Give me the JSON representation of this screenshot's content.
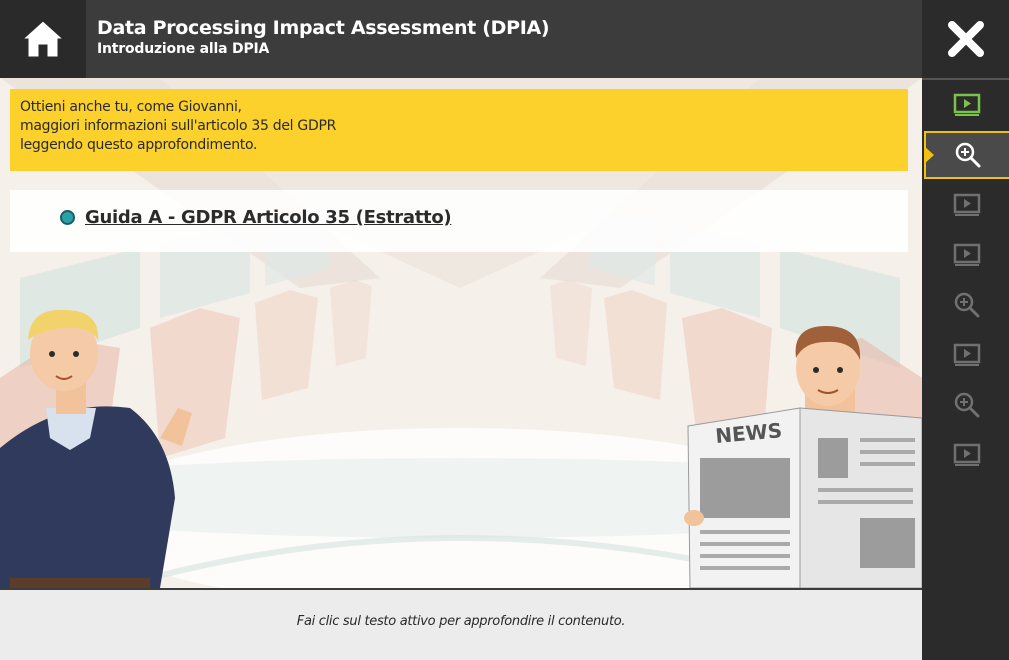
{
  "header": {
    "title": "Data Processing Impact Assessment (DPIA)",
    "subtitle": "Introduzione alla DPIA",
    "home_icon": "home-icon",
    "close_icon": "close-icon"
  },
  "banner": {
    "lines": [
      "Ottieni anche tu, come Giovanni,",
      "maggiori informazioni sull'articolo 35 del GDPR",
      "leggendo questo approfondimento."
    ]
  },
  "link": {
    "label": "Guida A - GDPR Articolo 35 (Estratto)"
  },
  "illustration": {
    "newspaper_label": "NEWS"
  },
  "footer": {
    "hint": "Fai clic sul testo attivo per approfondire il contenuto."
  },
  "sidebar": {
    "items": [
      {
        "icon": "video-icon",
        "state": "visited"
      },
      {
        "icon": "zoom-icon",
        "state": "active"
      },
      {
        "icon": "video-icon",
        "state": "locked"
      },
      {
        "icon": "video-icon",
        "state": "locked"
      },
      {
        "icon": "zoom-icon",
        "state": "locked"
      },
      {
        "icon": "video-icon",
        "state": "locked"
      },
      {
        "icon": "zoom-icon",
        "state": "locked"
      },
      {
        "icon": "video-icon",
        "state": "locked"
      }
    ]
  },
  "colors": {
    "banner": "#fdd12c",
    "accent_active": "#f2c011",
    "visited_green": "#7bc24a",
    "bullet": "#2aa0a8"
  }
}
